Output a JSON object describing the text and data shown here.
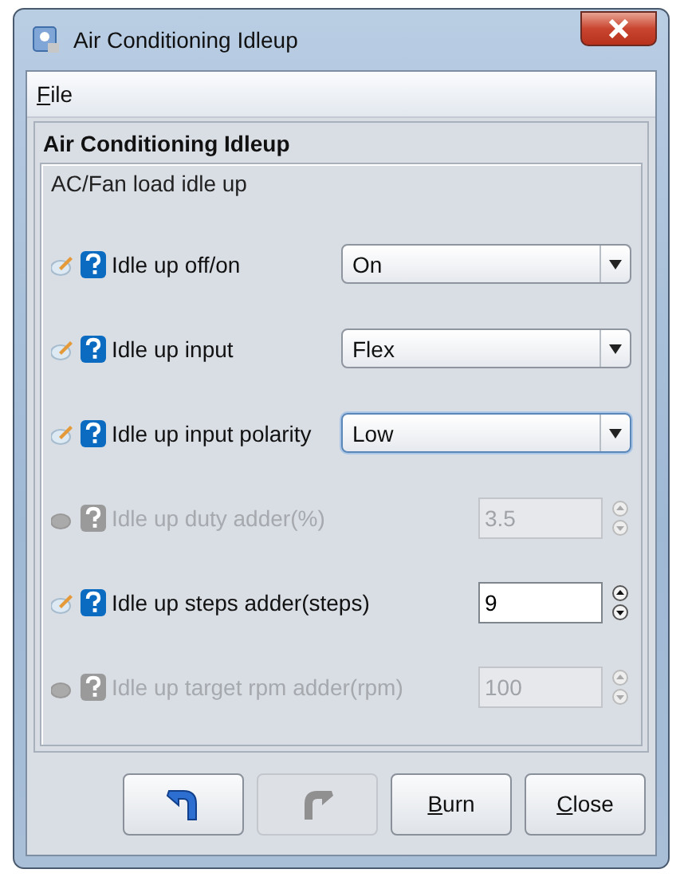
{
  "window": {
    "title": "Air Conditioning Idleup"
  },
  "menu": [
    {
      "label": "File"
    }
  ],
  "panel": {
    "title": "Air Conditioning Idleup",
    "subtitle": "AC/Fan load idle up"
  },
  "fields": [
    {
      "kind": "select",
      "label": "Idle up off/on",
      "value": "On",
      "disabled": false,
      "focused": false
    },
    {
      "kind": "select",
      "label": "Idle up input",
      "value": "Flex",
      "disabled": false,
      "focused": false
    },
    {
      "kind": "select",
      "label": "Idle up input polarity",
      "value": "Low",
      "disabled": false,
      "focused": true
    },
    {
      "kind": "spinner",
      "label": "Idle up duty adder(%)",
      "value": "3.5",
      "disabled": true,
      "focused": false
    },
    {
      "kind": "spinner",
      "label": "Idle up steps adder(steps)",
      "value": "9",
      "disabled": false,
      "focused": false
    },
    {
      "kind": "spinner",
      "label": "Idle up target rpm adder(rpm)",
      "value": "100",
      "disabled": true,
      "focused": false
    }
  ],
  "buttons": [
    {
      "kind": "undo",
      "disabled": false
    },
    {
      "kind": "redo",
      "disabled": true
    },
    {
      "kind": "text",
      "label": "Burn",
      "disabled": false
    },
    {
      "kind": "text",
      "label": "Close",
      "disabled": false
    }
  ]
}
